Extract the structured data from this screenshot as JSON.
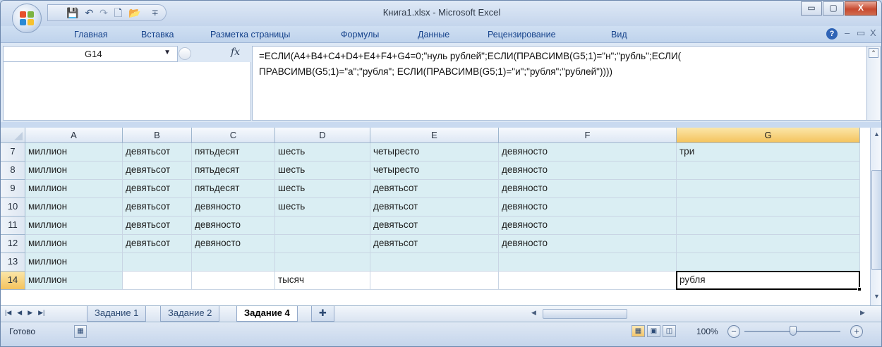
{
  "window": {
    "title": "Книга1.xlsx - Microsoft Excel",
    "buttons": {
      "minimize": "▭",
      "maximize": "▢",
      "close": "X"
    }
  },
  "quick_access": {
    "save": "💾",
    "undo": "↶",
    "redo": "↷",
    "new": "🗋",
    "open": "📂",
    "more": "∓"
  },
  "ribbon": {
    "tabs": [
      "Главная",
      "Вставка",
      "Разметка страницы",
      "Формулы",
      "Данные",
      "Рецензирование",
      "Вид"
    ],
    "help": "?",
    "mini": {
      "minimize": "–",
      "restore": "▭",
      "close": "X"
    }
  },
  "formula_bar": {
    "name_box": "G14",
    "fx": "fx",
    "formula_lines": [
      "=ЕСЛИ(A4+B4+C4+D4+E4+F4+G4=0;\"нуль рублей\";ЕСЛИ(ПРАВСИМВ(G5;1)=\"н\";\"рубль\";ЕСЛИ(",
      "ПРАВСИМВ(G5;1)=\"а\";\"рубля\"; ЕСЛИ(ПРАВСИМВ(G5;1)=\"и\";\"рубля\";\"рублей\"))))"
    ]
  },
  "sheet": {
    "columns": [
      "A",
      "B",
      "C",
      "D",
      "E",
      "F",
      "G"
    ],
    "active_cell": "G14",
    "rows": [
      {
        "num": "7",
        "cells": [
          "миллион",
          "девятьсот",
          "пятьдесят",
          "шесть",
          "четыресто",
          "девяносто",
          "три"
        ]
      },
      {
        "num": "8",
        "cells": [
          "миллион",
          "девятьсот",
          "пятьдесят",
          "шесть",
          "четыресто",
          "девяносто",
          ""
        ]
      },
      {
        "num": "9",
        "cells": [
          "миллион",
          "девятьсот",
          "пятьдесят",
          "шесть",
          "девятьсот",
          "девяносто",
          ""
        ]
      },
      {
        "num": "10",
        "cells": [
          "миллион",
          "девятьсот",
          "девяносто",
          "шесть",
          "девятьсот",
          "девяносто",
          ""
        ]
      },
      {
        "num": "11",
        "cells": [
          "миллион",
          "девятьсот",
          "девяносто",
          "",
          "девятьсот",
          "девяносто",
          ""
        ]
      },
      {
        "num": "12",
        "cells": [
          "миллион",
          "девятьсот",
          "девяносто",
          "",
          "девятьсот",
          "девяносто",
          ""
        ]
      },
      {
        "num": "13",
        "cells": [
          "миллион",
          "",
          "",
          "",
          "",
          "",
          ""
        ]
      },
      {
        "num": "14",
        "cells": [
          "миллион",
          "",
          "",
          "тысяч",
          "",
          "",
          "рубля"
        ]
      }
    ]
  },
  "sheet_tabs": {
    "nav": [
      "|◀",
      "◀",
      "▶",
      "▶|"
    ],
    "tabs": [
      "Задание 1",
      "Задание 2",
      "Задание 4"
    ],
    "active": "Задание 4",
    "insert": "✚"
  },
  "status": {
    "text": "Готово",
    "zoom": "100%",
    "zoom_out": "−",
    "zoom_in": "+"
  },
  "colors": {
    "cell_fill": "#daeef3",
    "active_header": "#f4c35d",
    "title_text": "#303a48",
    "tab_text": "#15428b"
  }
}
